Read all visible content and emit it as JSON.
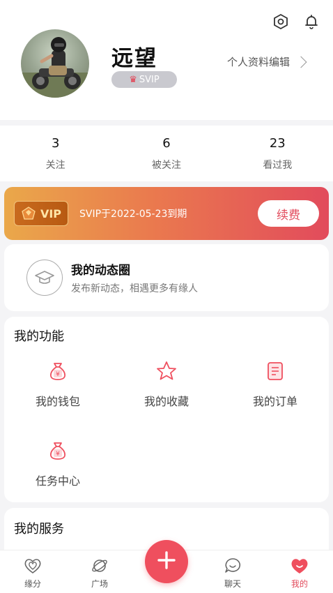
{
  "profile": {
    "username": "远望",
    "badge": "SVIP",
    "edit_label": "个人资料编辑"
  },
  "stats": [
    {
      "value": "3",
      "label": "关注"
    },
    {
      "value": "6",
      "label": "被关注"
    },
    {
      "value": "23",
      "label": "看过我"
    }
  ],
  "vip": {
    "tag": "VIP",
    "expiry": "SVIP于2022-05-23到期",
    "renew_label": "续费"
  },
  "moments": {
    "title": "我的动态圈",
    "subtitle": "发布新动态，相遇更多有缘人"
  },
  "functions": {
    "title": "我的功能",
    "items": [
      {
        "label": "我的钱包",
        "icon": "money-bag-icon"
      },
      {
        "label": "我的收藏",
        "icon": "star-icon"
      },
      {
        "label": "我的订单",
        "icon": "document-icon"
      },
      {
        "label": "任务中心",
        "icon": "money-bag-icon"
      }
    ]
  },
  "services": {
    "title": "我的服务"
  },
  "tabbar": {
    "items": [
      {
        "label": "缘分",
        "icon": "hearts-icon"
      },
      {
        "label": "广场",
        "icon": "planet-icon"
      },
      {
        "label": "聊天",
        "icon": "chat-bubble-icon"
      },
      {
        "label": "我的",
        "icon": "smiling-heart-icon"
      }
    ],
    "active_color": "#e24b5c"
  },
  "colors": {
    "accent": "#ef4f5e",
    "banner_start": "#eaa84a",
    "banner_end": "#e24b5c"
  }
}
